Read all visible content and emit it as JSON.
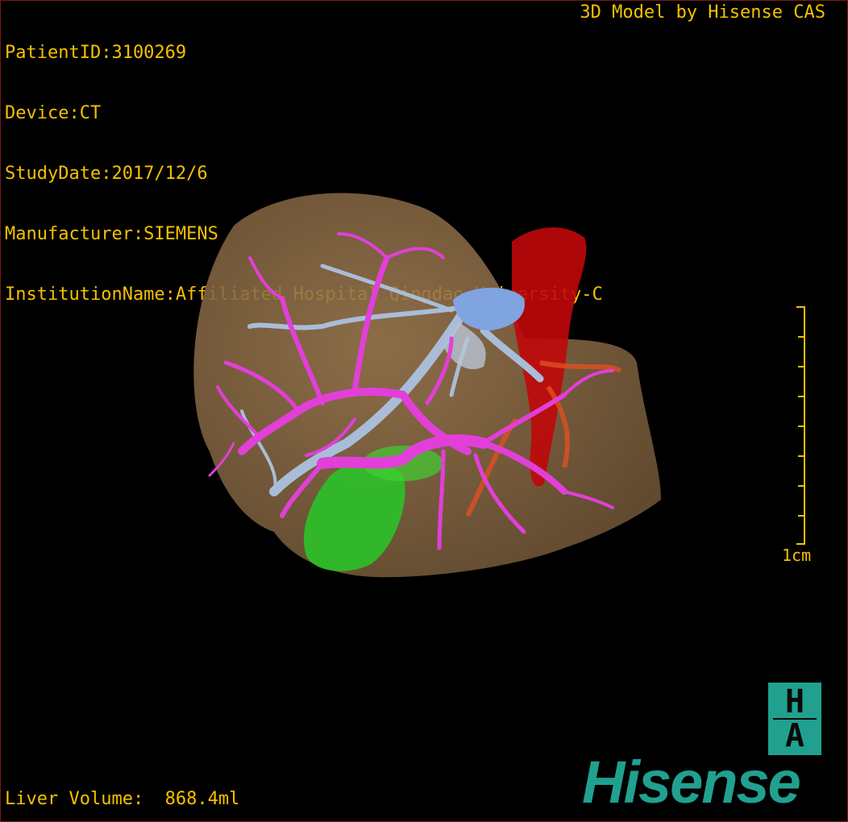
{
  "overlay": {
    "patient_id": "PatientID:3100269",
    "device": "Device:CT",
    "study_date": "StudyDate:2017/12/6",
    "manufacturer": "Manufacturer:SIEMENS",
    "institution": "InstitutionName:Affiliated Hospital Qingdao University-C",
    "model_credit": "3D Model by Hisense CAS",
    "liver_volume": "Liver Volume:  868.4ml"
  },
  "scale_bar": {
    "label": "1cm"
  },
  "logo": {
    "top_letter": "H",
    "bottom_letter": "A"
  },
  "brand": {
    "name": "Hisense"
  },
  "colors": {
    "hud_text": "#f5c000",
    "liver": "#8a6a45",
    "portal_vein": "#e23fd8",
    "hepatic_vein": "#a9bdd8",
    "ivc_aorta": "#c0080a",
    "gallbladder": "#28c828",
    "brand": "#21a090"
  }
}
